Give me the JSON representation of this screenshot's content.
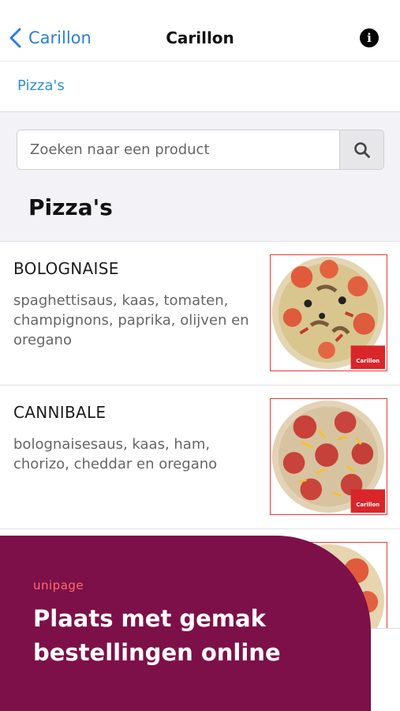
{
  "nav": {
    "back_label": "Carillon",
    "title": "Carillon",
    "info_glyph": "i"
  },
  "breadcrumb": {
    "label": "Pizza's"
  },
  "search": {
    "placeholder": "Zoeken naar een product"
  },
  "section": {
    "title": "Pizza's"
  },
  "products": [
    {
      "name": "BOLOGNAISE",
      "description": "spaghettisaus, kaas, tomaten, champignons, paprika, olijven en oregano",
      "badge": "Carillon"
    },
    {
      "name": "CANNIBALE",
      "description": "bolognaisesaus, kaas, ham, chorizo, cheddar en oregano",
      "badge": "Carillon"
    },
    {
      "name": "",
      "description": "",
      "badge": ""
    }
  ],
  "promo": {
    "logo": "unipage",
    "headline": "Plaats met gemak bestellingen online"
  },
  "colors": {
    "accent_blue": "#2b7fe0",
    "promo_bg": "#7d1049",
    "image_border": "#e33a3a"
  }
}
